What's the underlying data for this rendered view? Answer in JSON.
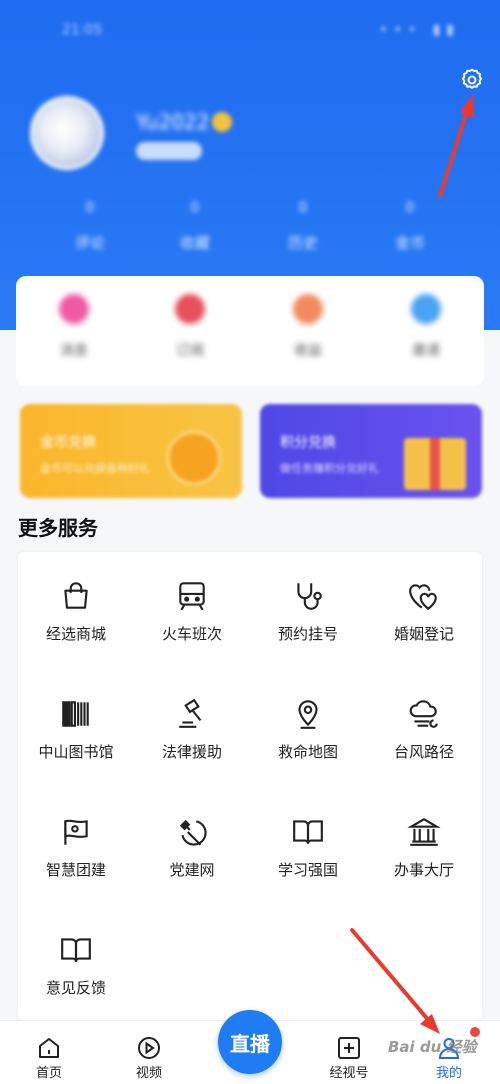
{
  "status_bar": {
    "time": "21:05",
    "icons": "••• ▮▮"
  },
  "user": {
    "name": "Yu2022",
    "badge": ""
  },
  "stats": [
    {
      "num": "0",
      "label": "评论"
    },
    {
      "num": "0",
      "label": "收藏"
    },
    {
      "num": "0",
      "label": "历史"
    },
    {
      "num": "0",
      "label": "金币"
    }
  ],
  "quick_items": [
    {
      "label": "消息",
      "color": "#f05aa5"
    },
    {
      "label": "订阅",
      "color": "#e8505b"
    },
    {
      "label": "收益",
      "color": "#f28a5e"
    },
    {
      "label": "邀请",
      "color": "#4aa3f5"
    }
  ],
  "promos": [
    {
      "title": "金币兑换",
      "subtitle": "金币可以兑换各种好礼",
      "color": "#f9b52c"
    },
    {
      "title": "积分兑换",
      "subtitle": "做任务赚积分兑好礼",
      "color": "#5a4de8"
    }
  ],
  "section_title": "更多服务",
  "services": [
    {
      "label": "经选商城",
      "icon": "shopping-bag-icon"
    },
    {
      "label": "火车班次",
      "icon": "train-icon"
    },
    {
      "label": "预约挂号",
      "icon": "stethoscope-icon"
    },
    {
      "label": "婚姻登记",
      "icon": "double-heart-icon"
    },
    {
      "label": "中山图书馆",
      "icon": "books-icon"
    },
    {
      "label": "法律援助",
      "icon": "gavel-icon"
    },
    {
      "label": "救命地图",
      "icon": "map-pin-icon"
    },
    {
      "label": "台风路径",
      "icon": "typhoon-cloud-icon"
    },
    {
      "label": "智慧团建",
      "icon": "league-flag-icon"
    },
    {
      "label": "党建网",
      "icon": "hammer-sickle-icon"
    },
    {
      "label": "学习强国",
      "icon": "open-book-icon"
    },
    {
      "label": "办事大厅",
      "icon": "bank-building-icon"
    },
    {
      "label": "意见反馈",
      "icon": "feedback-book-icon"
    }
  ],
  "tabs": [
    {
      "label": "首页",
      "icon": "home-icon"
    },
    {
      "label": "视频",
      "icon": "play-circle-icon"
    },
    {
      "label": "经视号",
      "icon": "plus-square-icon"
    },
    {
      "label": "我的",
      "icon": "user-icon"
    }
  ],
  "live_button": "直播",
  "watermark": "Bai du 经验",
  "colors": {
    "primary": "#1f6cf0",
    "accent_red": "#e94848",
    "arrow": "#e83b2e"
  }
}
